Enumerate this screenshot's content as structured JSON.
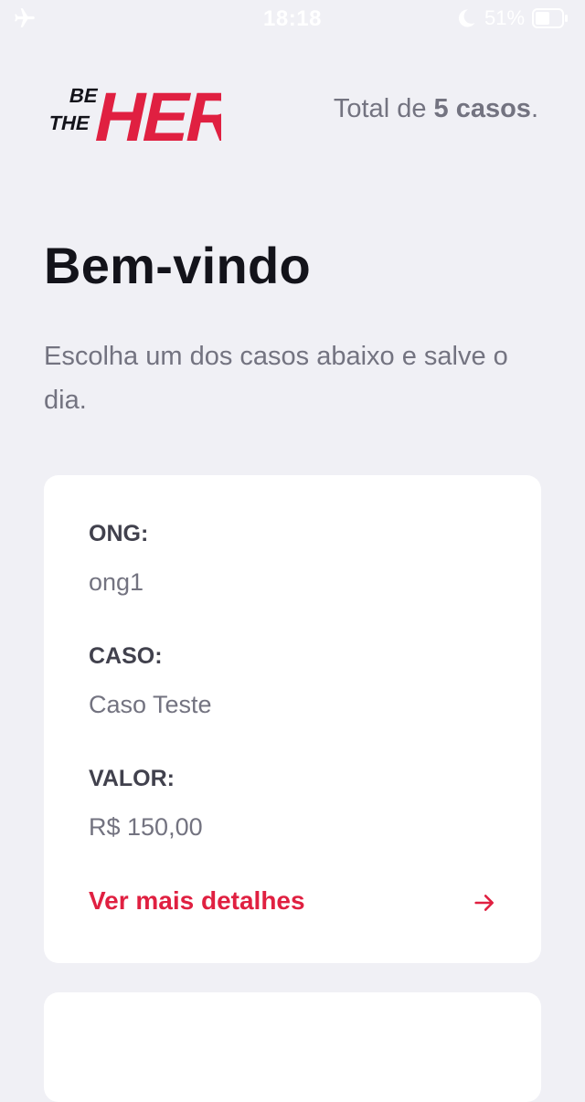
{
  "status_bar": {
    "time": "18:18",
    "battery": "51%",
    "icons": [
      "airplane-icon",
      "moon-icon",
      "battery-icon"
    ]
  },
  "header": {
    "logo_icon": "be-the-hero-logo",
    "logo_text": "BE THE HERO",
    "total_prefix": "Total de ",
    "total_count": "5 casos",
    "total_suffix": "."
  },
  "main": {
    "title": "Bem-vindo",
    "description": "Escolha um dos casos abaixo e salve o dia."
  },
  "incidents": [
    {
      "ong_label": "ONG:",
      "ong_value": "ong1",
      "case_label": "CASO:",
      "case_value": "Caso Teste",
      "value_label": "VALOR:",
      "value_value": "R$ 150,00",
      "details_label": "Ver mais detalhes",
      "details_icon": "arrow-right-icon"
    }
  ],
  "colors": {
    "background": "#f0f0f5",
    "brand_red": "#e02041",
    "title": "#13131a",
    "label": "#41414d",
    "text": "#737380",
    "card": "#ffffff"
  }
}
